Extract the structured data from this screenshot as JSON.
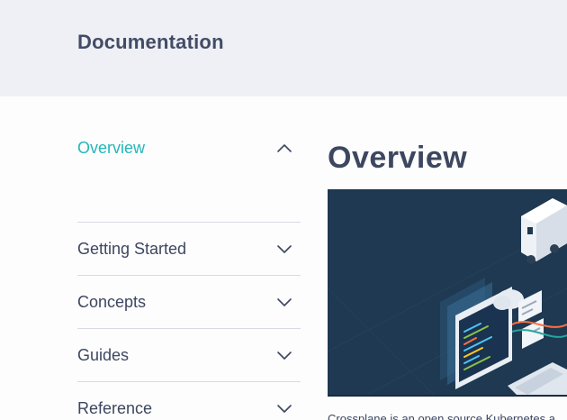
{
  "header": {
    "title": "Documentation"
  },
  "sidebar": {
    "items": [
      {
        "label": "Overview",
        "expanded": true,
        "active": true,
        "icon": "chevron-up-icon"
      },
      {
        "label": "Getting Started",
        "expanded": false,
        "active": false,
        "icon": "chevron-down-icon"
      },
      {
        "label": "Concepts",
        "expanded": false,
        "active": false,
        "icon": "chevron-down-icon"
      },
      {
        "label": "Guides",
        "expanded": false,
        "active": false,
        "icon": "chevron-down-icon"
      },
      {
        "label": "Reference",
        "expanded": false,
        "active": false,
        "icon": "chevron-down-icon"
      }
    ]
  },
  "main": {
    "title": "Overview",
    "intro": "Crossplane is an open source Kubernetes a"
  },
  "colors": {
    "accent": "#23b7ba",
    "text": "#3d4760",
    "header_bg": "#eef0f5",
    "hero_bg": "#1e3951"
  }
}
